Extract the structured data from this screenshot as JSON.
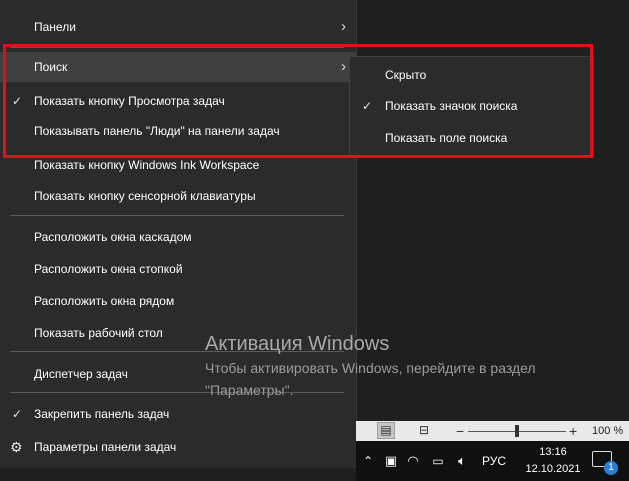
{
  "menu": {
    "items": [
      {
        "label": "Панели"
      },
      {
        "label": "Поиск"
      },
      {
        "label": "Показать кнопку Просмотра задач",
        "checked": true
      },
      {
        "label": "Показывать панель \"Люди\" на панели задач"
      },
      {
        "label": "Показать кнопку Windows Ink Workspace"
      },
      {
        "label": "Показать кнопку сенсорной клавиатуры"
      },
      {
        "label": "Расположить окна каскадом"
      },
      {
        "label": "Расположить окна стопкой"
      },
      {
        "label": "Расположить окна рядом"
      },
      {
        "label": "Показать рабочий стол"
      },
      {
        "label": "Диспетчер задач"
      },
      {
        "label": "Закрепить панель задач",
        "checked": true
      },
      {
        "label": "Параметры панели задач"
      }
    ]
  },
  "submenu": {
    "items": [
      {
        "label": "Скрыто"
      },
      {
        "label": "Показать значок поиска",
        "checked": true
      },
      {
        "label": "Показать поле поиска"
      }
    ]
  },
  "watermark": {
    "title": "Активация Windows",
    "line1": "Чтобы активировать Windows, перейдите в раздел",
    "line2": "\"Параметры\"."
  },
  "statusbar": {
    "zoom": "100 %"
  },
  "taskbar": {
    "language": "РУС",
    "time": "13:16",
    "date": "12.10.2021",
    "notification_count": "1"
  },
  "icons": {
    "check": "check-icon",
    "chevron": "chevron-right-icon",
    "gear": "gear-icon"
  },
  "colors": {
    "menu_bg": "#2b2b2b",
    "hover_bg": "#404040",
    "highlight": "#e0101a",
    "badge": "#2b7fd2"
  }
}
